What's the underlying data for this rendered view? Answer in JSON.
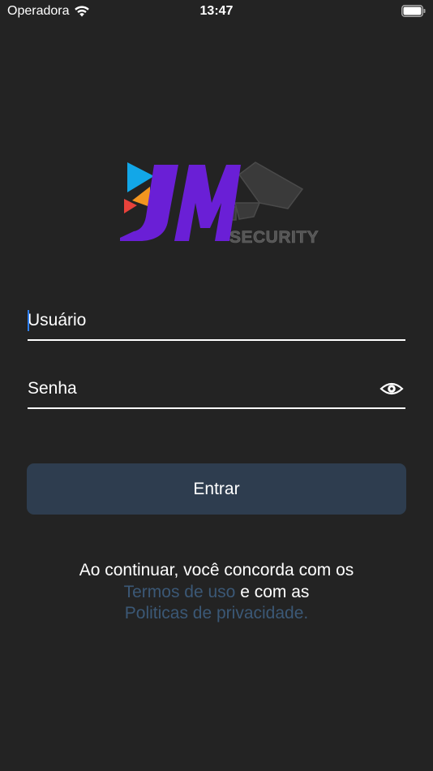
{
  "status_bar": {
    "carrier": "Operadora",
    "time": "13:47"
  },
  "logo": {
    "brand_main": "JM",
    "brand_sub": "SECURITY"
  },
  "form": {
    "username_placeholder": "Usuário",
    "password_placeholder": "Senha",
    "submit_label": "Entrar"
  },
  "terms": {
    "intro": "Ao continuar, você concorda com os",
    "terms_link": "Termos de uso",
    "conjunction": "e com as",
    "privacy_link": "Politicas de privacidade."
  },
  "colors": {
    "background": "#232323",
    "button": "#2e3d4f",
    "link": "#3b5876",
    "logo_purple": "#6a1fd6",
    "caret": "#2f7ff0"
  }
}
